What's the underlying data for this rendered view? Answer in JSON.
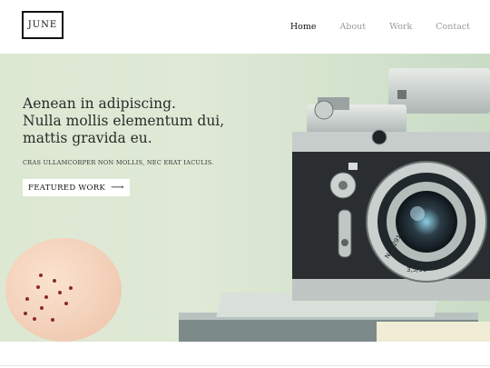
{
  "brand": {
    "logo_text": "JUNE"
  },
  "nav": {
    "items": [
      {
        "label": "Home",
        "active": true
      },
      {
        "label": "About",
        "active": false
      },
      {
        "label": "Work",
        "active": false
      },
      {
        "label": "Contact",
        "active": false
      }
    ]
  },
  "hero": {
    "headline": [
      "Aenean in adipiscing.",
      "Nulla mollis elementum dui,",
      "mattis  gravida eu."
    ],
    "subline": "CRAS ULLAMCORPER NON MOLLIS, NEC ERAT IACULIS.",
    "cta_label": "FEATURED WORK",
    "cta_arrow": "⟶",
    "lens_text": "N≗529187",
    "lens_aperture": "3,5/50"
  },
  "colors": {
    "accent": "#111111",
    "nav_inactive": "#9a9a9a",
    "hero_bg": "#dde8d2"
  }
}
